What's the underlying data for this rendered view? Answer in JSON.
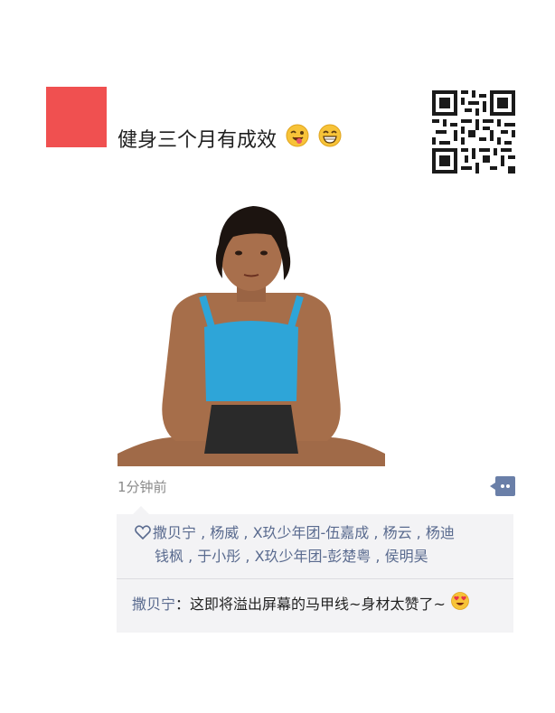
{
  "post": {
    "text": "健身三个月有成效",
    "emojis": [
      "winking-tongue-emoji",
      "grinning-emoji"
    ]
  },
  "meta": {
    "time": "1分钟前"
  },
  "likes": {
    "line1": [
      "撒贝宁",
      "杨威",
      "X玖少年团-伍嘉成",
      "杨云",
      "杨迪"
    ],
    "line2": [
      "钱枫",
      "于小彤",
      "X玖少年团-彭楚粤",
      "侯明昊"
    ],
    "sep1": [
      " ,",
      " ,",
      " ,",
      " ,"
    ],
    "sep2": [
      " ,",
      " ,",
      " ,"
    ]
  },
  "comment": {
    "author": "撒贝宁",
    "colon": "：",
    "text": "这即将溢出屏幕的马甲线~身材太赞了~",
    "emoji": "heart-eyes-emoji"
  },
  "colors": {
    "accent": "#5a6b8f",
    "avatar": "#f05050",
    "panel": "#f3f3f5"
  }
}
